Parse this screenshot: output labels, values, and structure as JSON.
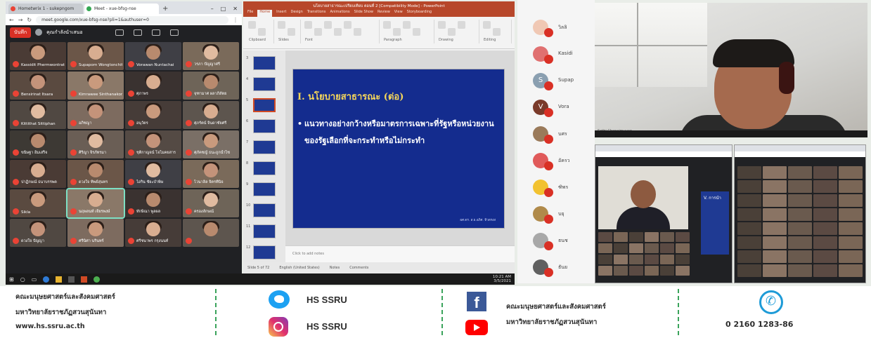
{
  "browser": {
    "tabs": [
      {
        "label": "Hometwrix 1 - sukepngom"
      },
      {
        "label": "Meet - xue-bfsg-nse"
      }
    ],
    "url": "meet.google.com/xue-bfsg-nse?pli=1&authuser=0",
    "record_label": "บันทึก",
    "meet_title": "คุณกำลังนำเสนอ",
    "participants": [
      "Kassidit Phermwontratorn",
      "Supaporn Wongtonchit",
      "Vorawan Nuntachai",
      "วรภา ปัญญาศรี",
      "Bensirinat Itsara",
      "Kimrawee Sinthanakon",
      "ศุภาพร",
      "จุฑามาศ ผลาภิสัตย",
      "Kittithat Sittiphan",
      "อภิชญา",
      "อนุวัตร",
      "ศุภรัตน์ จินดาชัยศรี",
      "ขนิษฐา อิ่มเสร็จ",
      "ศิริญา จิรภัทรมา",
      "ชุติกาญจน์ โจไมคยสาร",
      "ศุภัคชญ์ ธนะถูกน้ำไซ",
      "ปาฏิกษณ์ ธนาบรรพต",
      "ดวงใจ ทิพย์สุนทร",
      "ไอริน ชัยะบำพิษ",
      "ไวนาลิล จิตรที่นิจ",
      "Sikla",
      "นฤพลนท์ เจียรพงษ์",
      "ทักษิณา พูลผล",
      "ครองลักษณ์",
      "ดวงใจ ปัญญา",
      "ศรีนิศา นรินทร์",
      "ศรีชนาพร กรุงนนท์",
      ""
    ],
    "highlight_index": 21
  },
  "ppt": {
    "window_title": "นโยบายสาธารณะเปรียบเทียบ ตอนที่ 2 [Compatibility Mode] - PowerPoint",
    "tabs": [
      "File",
      "Home",
      "Insert",
      "Design",
      "Transitions",
      "Animations",
      "Slide Show",
      "Review",
      "View",
      "Storyboarding"
    ],
    "active_tab": "Home",
    "ribbon_labels": [
      "Clipboard",
      "Slides",
      "Font",
      "Paragraph",
      "Drawing",
      "Editing"
    ],
    "slide_numbers": [
      "3",
      "4",
      "5",
      "6",
      "7",
      "8",
      "9",
      "10",
      "11",
      "12"
    ],
    "selected_slide": "5",
    "slide": {
      "title": "I. นโยบายสาธารณะ (ต่อ)",
      "bullet": "แนวทางอย่างกว้างหรือมาตรการเฉพาะที่รัฐหรือหน่วยงานของรัฐเลือกที่จะกระทำหรือไม่กระทำ",
      "footer": "ผศ.ดร. ส.ย.อภิศ. ทิวตรงส"
    },
    "notes_placeholder": "Click to add notes",
    "status": [
      "Slide 5 of 72",
      "English (United States)",
      "Notes",
      "Comments"
    ]
  },
  "taskbar": {
    "clock_time": "10:21 AM",
    "clock_date": "3/5/2021"
  },
  "participant_list": [
    {
      "initial": "",
      "name": "วิลลิ",
      "color": "#f0c8b4"
    },
    {
      "initial": "",
      "name": "Kasidi",
      "color": "#e07070"
    },
    {
      "initial": "S",
      "name": "Supap",
      "color": "#8a9fb0"
    },
    {
      "initial": "V",
      "name": "Vora",
      "color": "#7a3a2a"
    },
    {
      "initial": "",
      "name": "บศร",
      "color": "#9a7a5a"
    },
    {
      "initial": "",
      "name": "อัครว",
      "color": "#e05a5a"
    },
    {
      "initial": "",
      "name": "ฑิพร",
      "color": "#f2c230"
    },
    {
      "initial": "",
      "name": "บยุ",
      "color": "#b08a4a"
    },
    {
      "initial": "",
      "name": "ธนช",
      "color": "#a8a8a8"
    },
    {
      "initial": "",
      "name": "ธันย",
      "color": "#606060"
    }
  ],
  "speaker": {
    "name_caption": "Sethi Chanaimuuan"
  },
  "mini_left_slide_text": "V. การนำ",
  "footer": {
    "org_line1": "คณะมนุษยศาสตร์และสังคมศาสตร์",
    "org_line2": "มหาวิทยาลัยราชภัฏสวนสุนันทา",
    "website": "www.hs.ssru.ac.th",
    "twitter_label": "HS SSRU",
    "instagram_label": "HS SSRU",
    "fb_line1": "คณะมนุษยศาสตร์และสังคมศาสตร์",
    "fb_line2": "มหาวิทยาลัยราชภัฏสวนสุนันทา",
    "phone": "0 2160 1283-86"
  },
  "colors": {
    "ppt_accent": "#b7472a",
    "slide_bg": "#142c8e",
    "slide_title": "#f5d65a",
    "mic_muted": "#ea4335",
    "footer_separator": "#3aa35b"
  }
}
